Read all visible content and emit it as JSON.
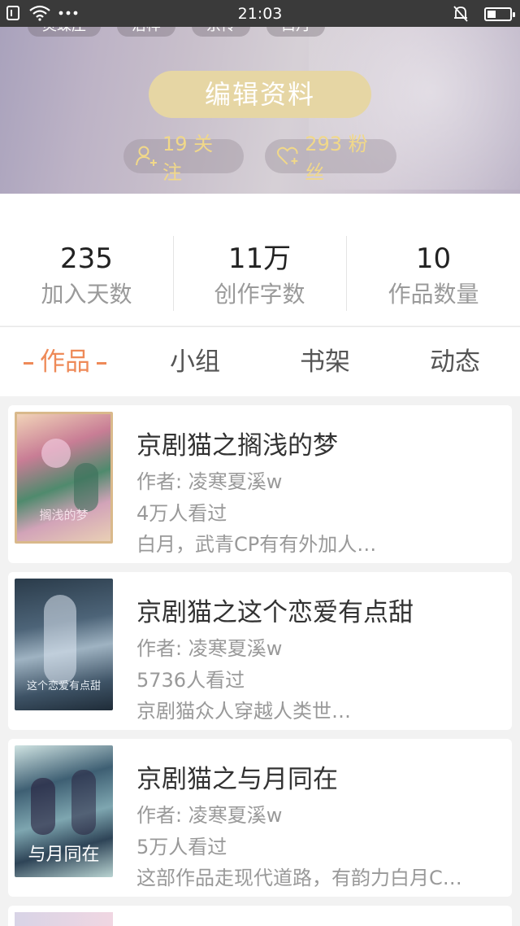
{
  "status_bar": {
    "time": "21:03"
  },
  "header": {
    "tags": [
      "灵蝶庄",
      "治样",
      "京传",
      "白月"
    ],
    "edit_button": "编辑资料",
    "following": "19 关注",
    "fans": "293 粉丝",
    "accent_color": "#e6d6a4"
  },
  "stats": [
    {
      "value": "235",
      "label": "加入天数"
    },
    {
      "value": "11万",
      "label": "创作字数"
    },
    {
      "value": "10",
      "label": "作品数量"
    }
  ],
  "tabs": {
    "items": [
      "作品",
      "小组",
      "书架",
      "动态"
    ],
    "active_color": "#ee8a58"
  },
  "works": [
    {
      "title": "京剧猫之搁浅的梦",
      "author": "作者: 凌寒夏溪w",
      "views": "4万人看过",
      "description": "白月，武青CP有有外加人…",
      "cover_text": "搁浅的梦"
    },
    {
      "title": "京剧猫之这个恋爱有点甜",
      "author": "作者: 凌寒夏溪w",
      "views": "5736人看过",
      "description": "京剧猫众人穿越人类世…",
      "cover_text": "这个恋爱有点甜"
    },
    {
      "title": "京剧猫之与月同在",
      "author": "作者: 凌寒夏溪w",
      "views": "5万人看过",
      "description": "这部作品走现代道路，有韵力白月C…",
      "cover_text": "与月同在"
    }
  ]
}
